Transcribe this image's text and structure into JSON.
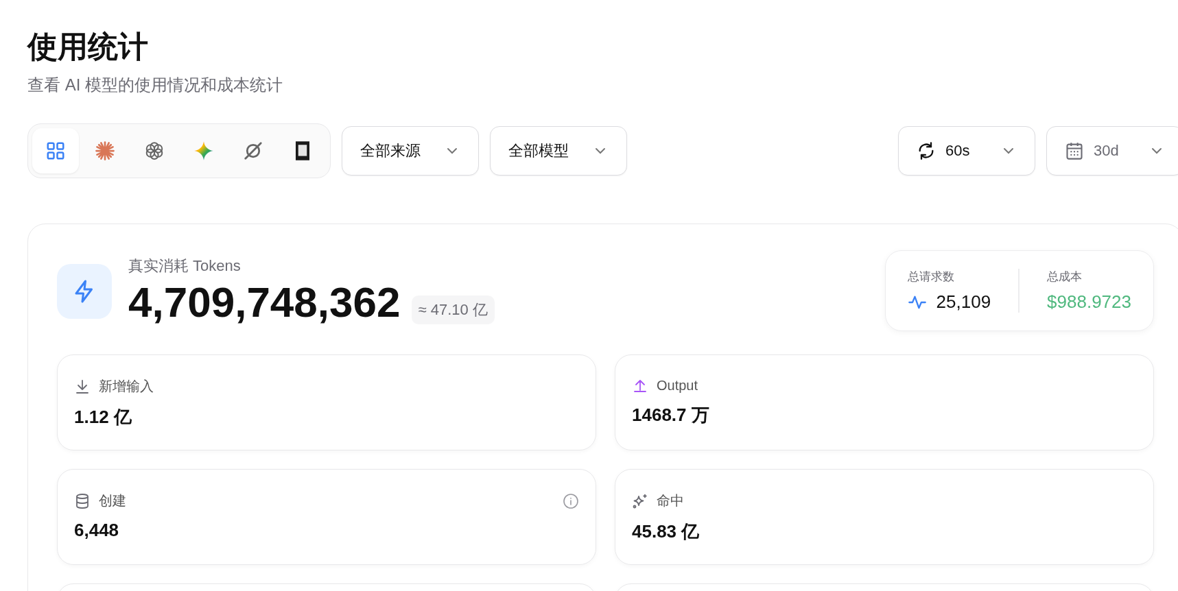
{
  "page": {
    "title": "使用统计",
    "subtitle": "查看 AI 模型的使用情况和成本统计"
  },
  "toolbar": {
    "providers": [
      {
        "kind": "all",
        "selected": true
      },
      {
        "kind": "burst",
        "selected": false
      },
      {
        "kind": "knot",
        "selected": false
      },
      {
        "kind": "star",
        "selected": false
      },
      {
        "kind": "slash",
        "selected": false
      },
      {
        "kind": "square",
        "selected": false
      }
    ],
    "filters": [
      {
        "label": "全部来源"
      },
      {
        "label": "全部模型"
      }
    ],
    "refresh": {
      "label": "60s"
    },
    "range": {
      "label": "30d"
    }
  },
  "summary": {
    "label": "真实消耗 Tokens",
    "value": "4,709,748,362",
    "approx": "≈ 47.10 亿",
    "requests": {
      "label": "总请求数",
      "value": "25,109"
    },
    "cost": {
      "label": "总成本",
      "value": "$988.9723"
    }
  },
  "cards": [
    {
      "kind": "download",
      "label": "新增输入",
      "value": "1.12 亿",
      "info": false
    },
    {
      "kind": "upload",
      "label": "Output",
      "value": "1468.7 万",
      "info": false
    },
    {
      "kind": "database",
      "label": "创建",
      "value": "6,448",
      "info": true
    },
    {
      "kind": "sparkles",
      "label": "命中",
      "value": "45.83 亿",
      "info": false
    }
  ]
}
